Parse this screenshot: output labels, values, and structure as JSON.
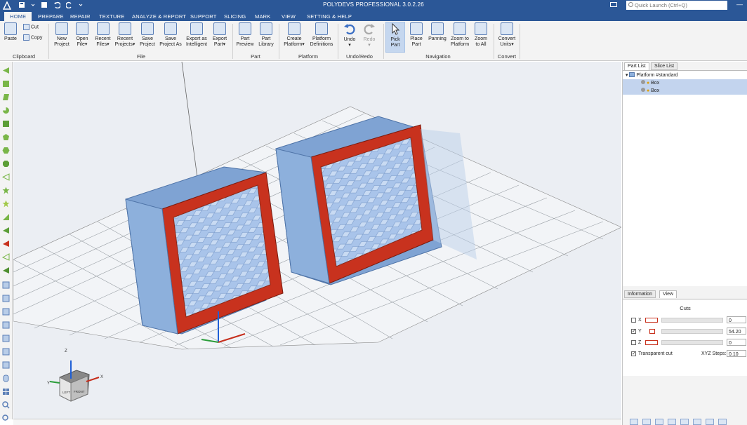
{
  "window": {
    "title": "POLYDEVS PROFESSIONAL 3.0.2.26",
    "quick_launch_placeholder": "Quick Launch (Ctrl+Q)",
    "min_icon": "minimize-icon",
    "max_icon": "maximize-icon",
    "close_icon": "close-icon"
  },
  "menu_tabs": [
    "HOME",
    "PREPARE",
    "REPAIR",
    "TEXTURE",
    "ANALYZE & REPORT",
    "SUPPORT",
    "SLICING",
    "MARK",
    "VIEW",
    "SETTING & HELP"
  ],
  "ribbon": {
    "clipboard": {
      "paste": "Paste",
      "cut": "Cut",
      "copy": "Copy",
      "group": "Clipboard"
    },
    "file": {
      "new": [
        "New",
        "Project"
      ],
      "open": [
        "Open",
        "File"
      ],
      "recent_files": [
        "Recent",
        "Files"
      ],
      "recent_projects": [
        "Recent",
        "Projects"
      ],
      "save": [
        "Save",
        "Project"
      ],
      "save_as": [
        "Save",
        "Project As"
      ],
      "export_intelligent": [
        "Export as",
        "Intelligent"
      ],
      "export_part": [
        "Export",
        "Part"
      ],
      "group": "File"
    },
    "part": {
      "preview": [
        "Part",
        "Preview"
      ],
      "library": [
        "Part",
        "Library"
      ],
      "group": "Part"
    },
    "platform": {
      "create": [
        "Create",
        "Platform"
      ],
      "definitions": [
        "Platform",
        "Definitions"
      ],
      "group": "Platform"
    },
    "undoredo": {
      "undo": "Undo",
      "redo": "Redo",
      "group": "Undo/Redo"
    },
    "navigation": {
      "pick": [
        "Pick",
        "Part"
      ],
      "place": [
        "Place",
        "Part"
      ],
      "panning": "Panning",
      "zoom_platform": [
        "Zoom to",
        "Platform"
      ],
      "zoom_all": [
        "Zoom",
        "to All"
      ],
      "group": "Navigation"
    },
    "convert": {
      "units": [
        "Convert",
        "Units"
      ],
      "group": "Convert"
    }
  },
  "right_panel": {
    "tabs": [
      "Part List",
      "Slice List"
    ],
    "tree": {
      "root": "Platform #standard",
      "items": [
        "Box",
        "Box"
      ]
    },
    "info_tabs": [
      "Information",
      "View"
    ],
    "cuts_title": "Cuts",
    "cuts": [
      {
        "axis": "X",
        "checked": false,
        "value": "0"
      },
      {
        "axis": "Y",
        "checked": true,
        "value": "54.20"
      },
      {
        "axis": "Z",
        "checked": false,
        "value": "0"
      }
    ],
    "transparent_cut": {
      "label": "Transparent cut",
      "checked": true
    },
    "xyz_steps": {
      "label": "XYZ Steps:",
      "value": "0.10"
    }
  },
  "viewcube": {
    "front": "FRONT",
    "left": "LEFT",
    "axes": [
      "Z",
      "Y",
      "X"
    ]
  },
  "colors": {
    "accent": "#2b5797",
    "part_blue": "#8fb3e0",
    "cut_red": "#c8321e",
    "grid": "#9aa0a6"
  }
}
